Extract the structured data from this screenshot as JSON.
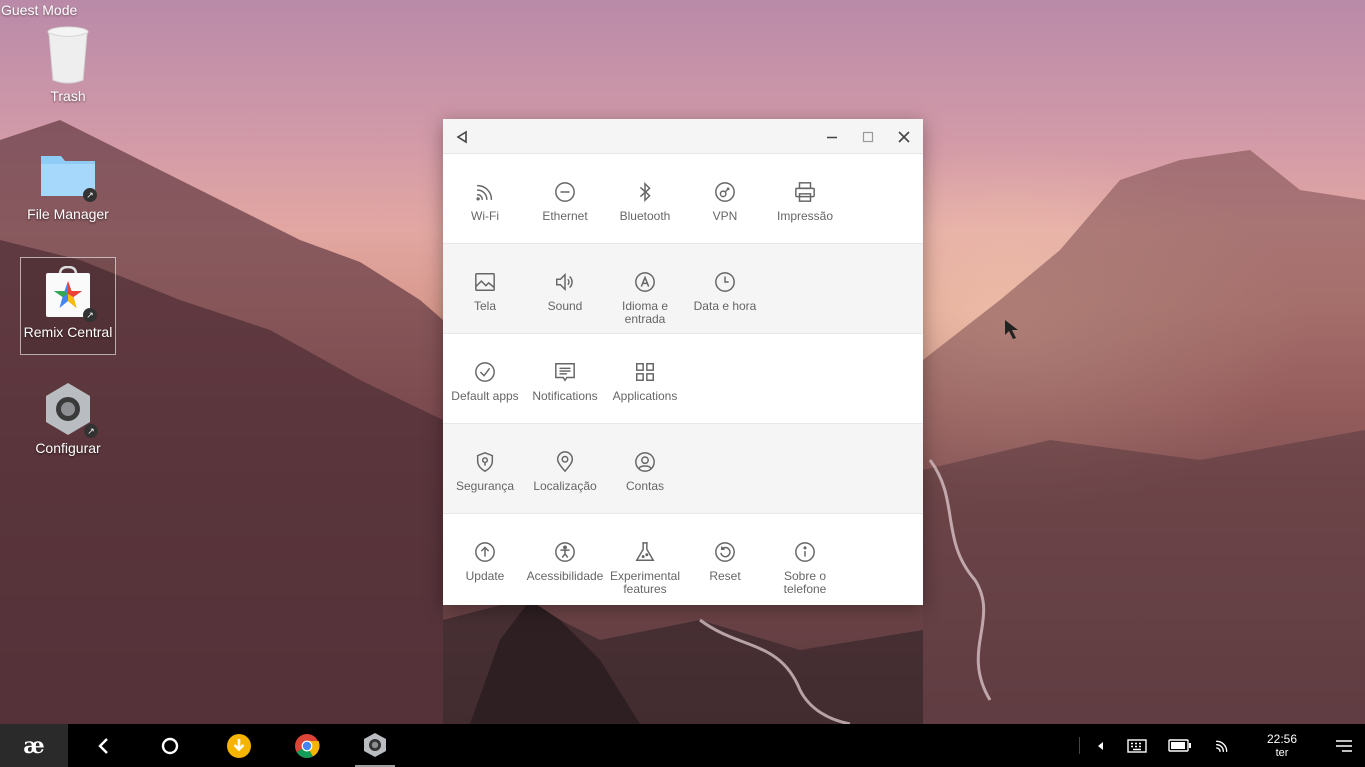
{
  "desktop": {
    "guest_mode": "Guest Mode",
    "icons": [
      {
        "label": "Trash",
        "icon": "trash-icon"
      },
      {
        "label": "File Manager",
        "icon": "folder-icon"
      },
      {
        "label": "Remix Central",
        "icon": "remix-central-icon"
      },
      {
        "label": "Configurar",
        "icon": "settings-gear-icon"
      }
    ]
  },
  "settings": {
    "sections": [
      [
        {
          "label": "Wi-Fi",
          "icon": "wifi-icon"
        },
        {
          "label": "Ethernet",
          "icon": "ethernet-icon"
        },
        {
          "label": "Bluetooth",
          "icon": "bluetooth-icon"
        },
        {
          "label": "VPN",
          "icon": "vpn-icon"
        },
        {
          "label": "Impressão",
          "icon": "printer-icon"
        }
      ],
      [
        {
          "label": "Tela",
          "icon": "display-icon"
        },
        {
          "label": "Sound",
          "icon": "speaker-icon"
        },
        {
          "label": "Idioma e entrada",
          "icon": "language-icon"
        },
        {
          "label": "Data e hora",
          "icon": "clock-icon"
        }
      ],
      [
        {
          "label": "Default apps",
          "icon": "check-circle-icon"
        },
        {
          "label": "Notifications",
          "icon": "notification-icon"
        },
        {
          "label": "Applications",
          "icon": "apps-grid-icon"
        }
      ],
      [
        {
          "label": "Segurança",
          "icon": "shield-icon"
        },
        {
          "label": "Localização",
          "icon": "location-pin-icon"
        },
        {
          "label": "Contas",
          "icon": "account-icon"
        }
      ],
      [
        {
          "label": "Update",
          "icon": "update-arrow-icon"
        },
        {
          "label": "Acessibilidade",
          "icon": "accessibility-icon"
        },
        {
          "label": "Experimental features",
          "icon": "flask-icon"
        },
        {
          "label": "Reset",
          "icon": "reset-icon"
        },
        {
          "label": "Sobre o telefone",
          "icon": "info-icon"
        }
      ]
    ]
  },
  "taskbar": {
    "clock_time": "22:56",
    "clock_day": "ter"
  }
}
